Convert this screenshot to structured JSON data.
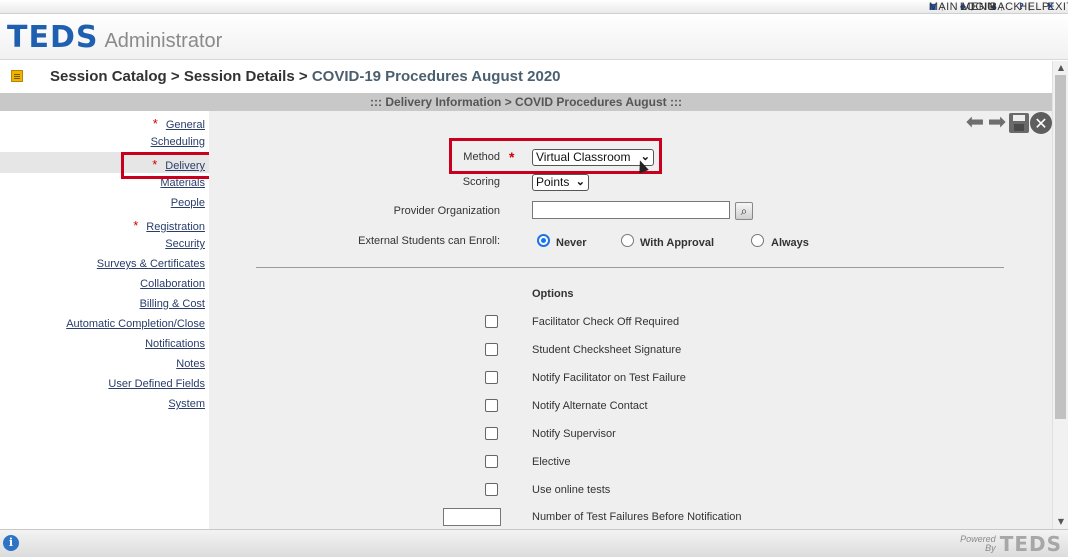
{
  "top_menu": [
    {
      "label": "MAIN MENU",
      "icon": "square-icon"
    },
    {
      "label": "LOGIN",
      "icon": "diamond-icon"
    },
    {
      "label": "BACK",
      "icon": "triangle-left-icon"
    },
    {
      "label": "HELP",
      "icon": "question-icon"
    },
    {
      "label": "EXIT",
      "icon": "x-icon"
    }
  ],
  "header": {
    "logo": "TEDS",
    "app_name": "Administrator"
  },
  "breadcrumb": {
    "part1": "Session Catalog",
    "sep1": " > ",
    "part2": "Session Details",
    "sep2": " > ",
    "current": "COVID-19 Procedures August 2020"
  },
  "section_title": "::: Delivery Information > COVID Procedures August :::",
  "sidebar": {
    "items": [
      {
        "label": "General",
        "required": true
      },
      {
        "label": "Scheduling",
        "required": false
      },
      {
        "label": "Delivery",
        "required": true,
        "selected": true
      },
      {
        "label": "Materials",
        "required": false
      },
      {
        "label": "People",
        "required": false
      },
      {
        "label": "Registration",
        "required": true
      },
      {
        "label": "Security",
        "required": false
      },
      {
        "label": "Surveys & Certificates",
        "required": false
      },
      {
        "label": "Collaboration",
        "required": false
      },
      {
        "label": "Billing & Cost",
        "required": false
      },
      {
        "label": "Automatic Completion/Close",
        "required": false
      },
      {
        "label": "Notifications",
        "required": false
      },
      {
        "label": "Notes",
        "required": false
      },
      {
        "label": "User Defined Fields",
        "required": false
      },
      {
        "label": "System",
        "required": false
      }
    ],
    "required_mark": "*"
  },
  "form": {
    "method_label": "Method",
    "method_value": "Virtual Classroom",
    "scoring_label": "Scoring",
    "scoring_value": "Points",
    "provider_label": "Provider Organization",
    "provider_value": "",
    "external_label": "External Students can Enroll:",
    "enroll_options": [
      "Never",
      "With Approval",
      "Always"
    ],
    "enroll_selected": "Never",
    "options_header": "Options",
    "options": [
      {
        "label": "Facilitator Check Off Required",
        "checked": false
      },
      {
        "label": "Student Checksheet Signature",
        "checked": false
      },
      {
        "label": "Notify Facilitator on Test Failure",
        "checked": false
      },
      {
        "label": "Notify Alternate Contact",
        "checked": false
      },
      {
        "label": "Notify Supervisor",
        "checked": false
      },
      {
        "label": "Elective",
        "checked": false
      },
      {
        "label": "Use online tests",
        "checked": false
      }
    ],
    "test_failures_label": "Number of Test Failures Before Notification",
    "test_failures_value": ""
  },
  "footer": {
    "powered_line1": "Powered",
    "powered_line2": "By",
    "powered_logo": "TEDS"
  },
  "colors": {
    "highlight_box": "#c8001e",
    "logo_blue": "#1f5fb0",
    "required_star": "#cc0000"
  }
}
